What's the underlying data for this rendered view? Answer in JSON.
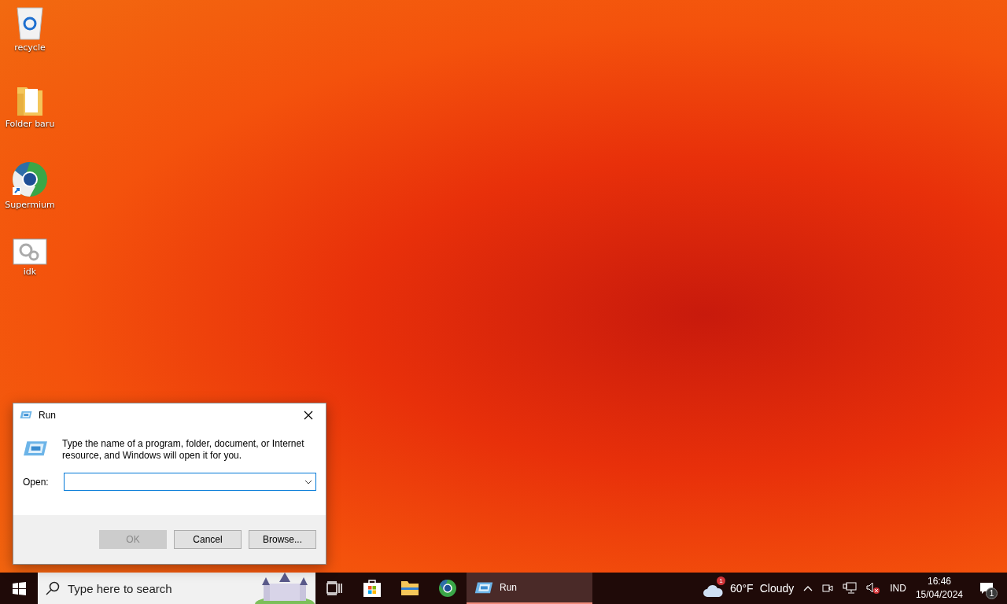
{
  "desktop_icons": [
    {
      "label": "recycle",
      "kind": "recycle"
    },
    {
      "label": "Folder baru",
      "kind": "folder"
    },
    {
      "label": "Supermium",
      "kind": "browser"
    },
    {
      "label": "idk",
      "kind": "app"
    }
  ],
  "dialog": {
    "title": "Run",
    "message": "Type the name of a program, folder, document, or Internet resource, and Windows will open it for you.",
    "open_label": "Open:",
    "buttons": [
      {
        "label": "OK",
        "disabled": true
      },
      {
        "label": "Cancel",
        "disabled": false
      },
      {
        "label": "Browse...",
        "disabled": false
      }
    ]
  },
  "taskbar": {
    "search": {
      "placeholder": "Type here to search"
    },
    "pinned": [
      {
        "kind": "taskview"
      },
      {
        "kind": "store"
      },
      {
        "kind": "folder"
      },
      {
        "kind": "browser"
      }
    ],
    "windows": [
      {
        "label": "Run",
        "selected": true
      }
    ],
    "weather": {
      "badge": "1",
      "temperature": "60°F",
      "condition": "Cloudy"
    },
    "language": "IND",
    "time": "16:46",
    "date": "15/04/2024",
    "notification_count": "1"
  }
}
